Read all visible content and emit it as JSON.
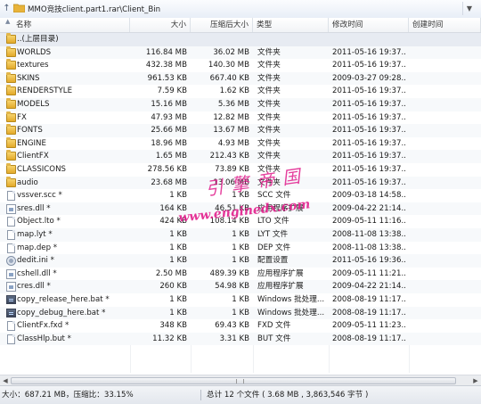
{
  "address": {
    "path": "MMO竞技client.part1.rar\\Client_Bin"
  },
  "columns": {
    "name": "名称",
    "size": "大小",
    "packed": "压缩后大小",
    "type": "类型",
    "modified": "修改时间",
    "created": "创建时间"
  },
  "parent_row": {
    "label": "..(上层目录)",
    "icon": "folder-up-icon"
  },
  "rows": [
    {
      "name": "WORLDS",
      "size": "116.84 MB",
      "packed": "36.02 MB",
      "type": "文件夹",
      "modified": "2011-05-16 19:37...",
      "icon": "folder"
    },
    {
      "name": "textures",
      "size": "432.38 MB",
      "packed": "140.30 MB",
      "type": "文件夹",
      "modified": "2011-05-16 19:37...",
      "icon": "folder"
    },
    {
      "name": "SKINS",
      "size": "961.53 KB",
      "packed": "667.40 KB",
      "type": "文件夹",
      "modified": "2009-03-27 09:28...",
      "icon": "folder"
    },
    {
      "name": "RENDERSTYLE",
      "size": "7.59 KB",
      "packed": "1.62 KB",
      "type": "文件夹",
      "modified": "2011-05-16 19:37...",
      "icon": "folder"
    },
    {
      "name": "MODELS",
      "size": "15.16 MB",
      "packed": "5.36 MB",
      "type": "文件夹",
      "modified": "2011-05-16 19:37...",
      "icon": "folder"
    },
    {
      "name": "FX",
      "size": "47.93 MB",
      "packed": "12.82 MB",
      "type": "文件夹",
      "modified": "2011-05-16 19:37...",
      "icon": "folder"
    },
    {
      "name": "FONTS",
      "size": "25.66 MB",
      "packed": "13.67 MB",
      "type": "文件夹",
      "modified": "2011-05-16 19:37...",
      "icon": "folder"
    },
    {
      "name": "ENGINE",
      "size": "18.96 MB",
      "packed": "4.93 MB",
      "type": "文件夹",
      "modified": "2011-05-16 19:37...",
      "icon": "folder"
    },
    {
      "name": "ClientFX",
      "size": "1.65 MB",
      "packed": "212.43 KB",
      "type": "文件夹",
      "modified": "2011-05-16 19:37...",
      "icon": "folder"
    },
    {
      "name": "CLASSICONS",
      "size": "278.56 KB",
      "packed": "73.89 KB",
      "type": "文件夹",
      "modified": "2011-05-16 19:37...",
      "icon": "folder"
    },
    {
      "name": "audio",
      "size": "23.68 MB",
      "packed": "13.06 MB",
      "type": "文件夹",
      "modified": "2011-05-16 19:37...",
      "icon": "folder"
    },
    {
      "name": "vssver.scc *",
      "size": "1 KB",
      "packed": "1 KB",
      "type": "SCC 文件",
      "modified": "2009-03-18 14:58...",
      "icon": "file"
    },
    {
      "name": "sres.dll *",
      "size": "164 KB",
      "packed": "46.51 KB",
      "type": "应用程序扩展",
      "modified": "2009-04-22 21:14...",
      "icon": "dll"
    },
    {
      "name": "Object.lto *",
      "size": "424 KB",
      "packed": "108.14 KB",
      "type": "LTO 文件",
      "modified": "2009-05-11 11:16...",
      "icon": "file"
    },
    {
      "name": "map.lyt *",
      "size": "1 KB",
      "packed": "1 KB",
      "type": "LYT 文件",
      "modified": "2008-11-08 13:38...",
      "icon": "file"
    },
    {
      "name": "map.dep *",
      "size": "1 KB",
      "packed": "1 KB",
      "type": "DEP 文件",
      "modified": "2008-11-08 13:38...",
      "icon": "file"
    },
    {
      "name": "dedit.ini *",
      "size": "1 KB",
      "packed": "1 KB",
      "type": "配置设置",
      "modified": "2011-05-16 19:36...",
      "icon": "gear"
    },
    {
      "name": "cshell.dll *",
      "size": "2.50 MB",
      "packed": "489.39 KB",
      "type": "应用程序扩展",
      "modified": "2009-05-11 11:21...",
      "icon": "dll"
    },
    {
      "name": "cres.dll *",
      "size": "260 KB",
      "packed": "54.98 KB",
      "type": "应用程序扩展",
      "modified": "2009-04-22 21:14...",
      "icon": "dll"
    },
    {
      "name": "copy_release_here.bat *",
      "size": "1 KB",
      "packed": "1 KB",
      "type": "Windows 批处理...",
      "modified": "2008-08-19 11:17...",
      "icon": "bat"
    },
    {
      "name": "copy_debug_here.bat *",
      "size": "1 KB",
      "packed": "1 KB",
      "type": "Windows 批处理...",
      "modified": "2008-08-19 11:17...",
      "icon": "bat"
    },
    {
      "name": "ClientFx.fxd *",
      "size": "348 KB",
      "packed": "69.43 KB",
      "type": "FXD 文件",
      "modified": "2009-05-11 11:23...",
      "icon": "file"
    },
    {
      "name": "ClassHlp.but *",
      "size": "11.32 KB",
      "packed": "3.31 KB",
      "type": "BUT 文件",
      "modified": "2008-08-19 11:17...",
      "icon": "file"
    }
  ],
  "watermark": {
    "cn_text": "引擎帝国",
    "url_text": "www.enginedx.com"
  },
  "status": {
    "left": "大小：687.21 MB，压缩比：33.15%",
    "right": "总计 12 个文件 ( 3.68 MB , 3,863,546 字节 )"
  }
}
